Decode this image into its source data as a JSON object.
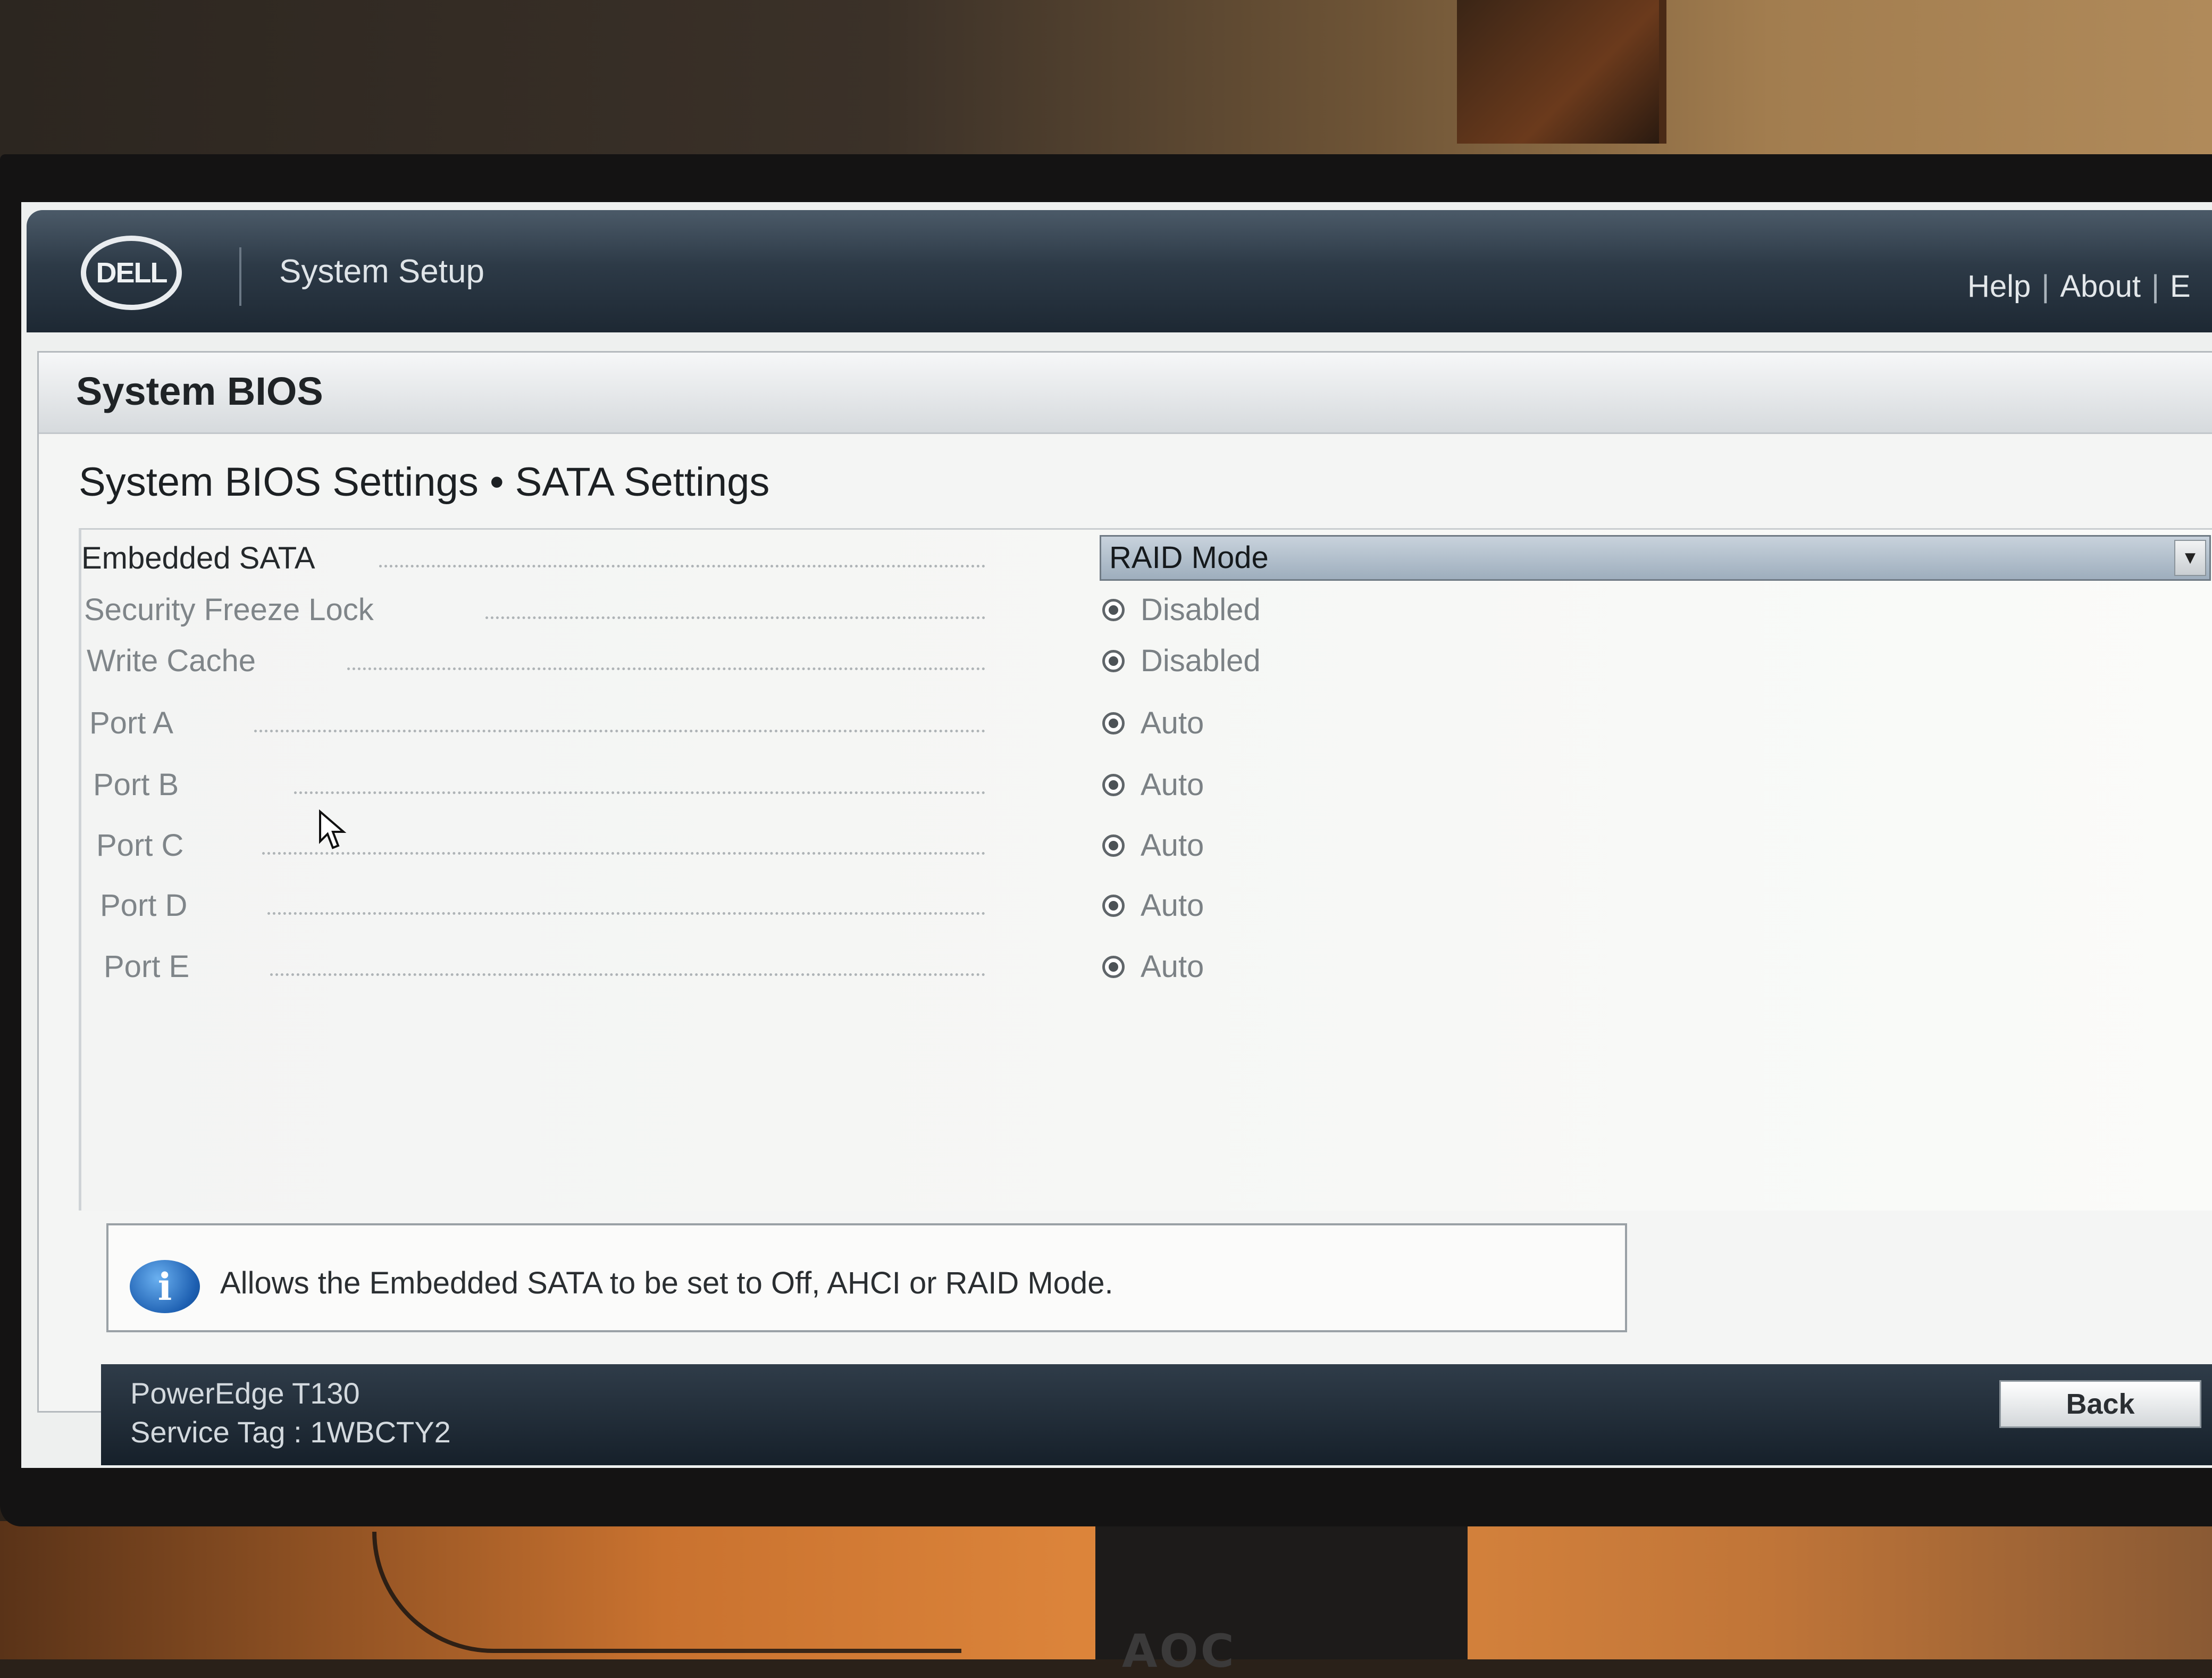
{
  "monitor": {
    "brand": "AOC"
  },
  "header": {
    "logo_text": "DELL",
    "app_title": "System Setup",
    "links": [
      "Help",
      "About",
      "E"
    ]
  },
  "section": {
    "title": "System BIOS"
  },
  "page": {
    "heading": "System BIOS Settings • SATA Settings"
  },
  "settings": [
    {
      "label": "Embedded SATA",
      "type": "select",
      "value": "RAID Mode"
    },
    {
      "label": "Security Freeze Lock",
      "type": "radio",
      "value": "Disabled"
    },
    {
      "label": "Write Cache",
      "type": "radio",
      "value": "Disabled"
    },
    {
      "label": "Port A",
      "type": "radio",
      "value": "Auto"
    },
    {
      "label": "Port B",
      "type": "radio",
      "value": "Auto"
    },
    {
      "label": "Port C",
      "type": "radio",
      "value": "Auto"
    },
    {
      "label": "Port D",
      "type": "radio",
      "value": "Auto"
    },
    {
      "label": "Port E",
      "type": "radio",
      "value": "Auto"
    }
  ],
  "help": {
    "text": "Allows the Embedded SATA to be set to Off, AHCI or RAID Mode."
  },
  "footer": {
    "model": "PowerEdge T130",
    "service_tag": "Service Tag : 1WBCTY2",
    "back_label": "Back"
  }
}
